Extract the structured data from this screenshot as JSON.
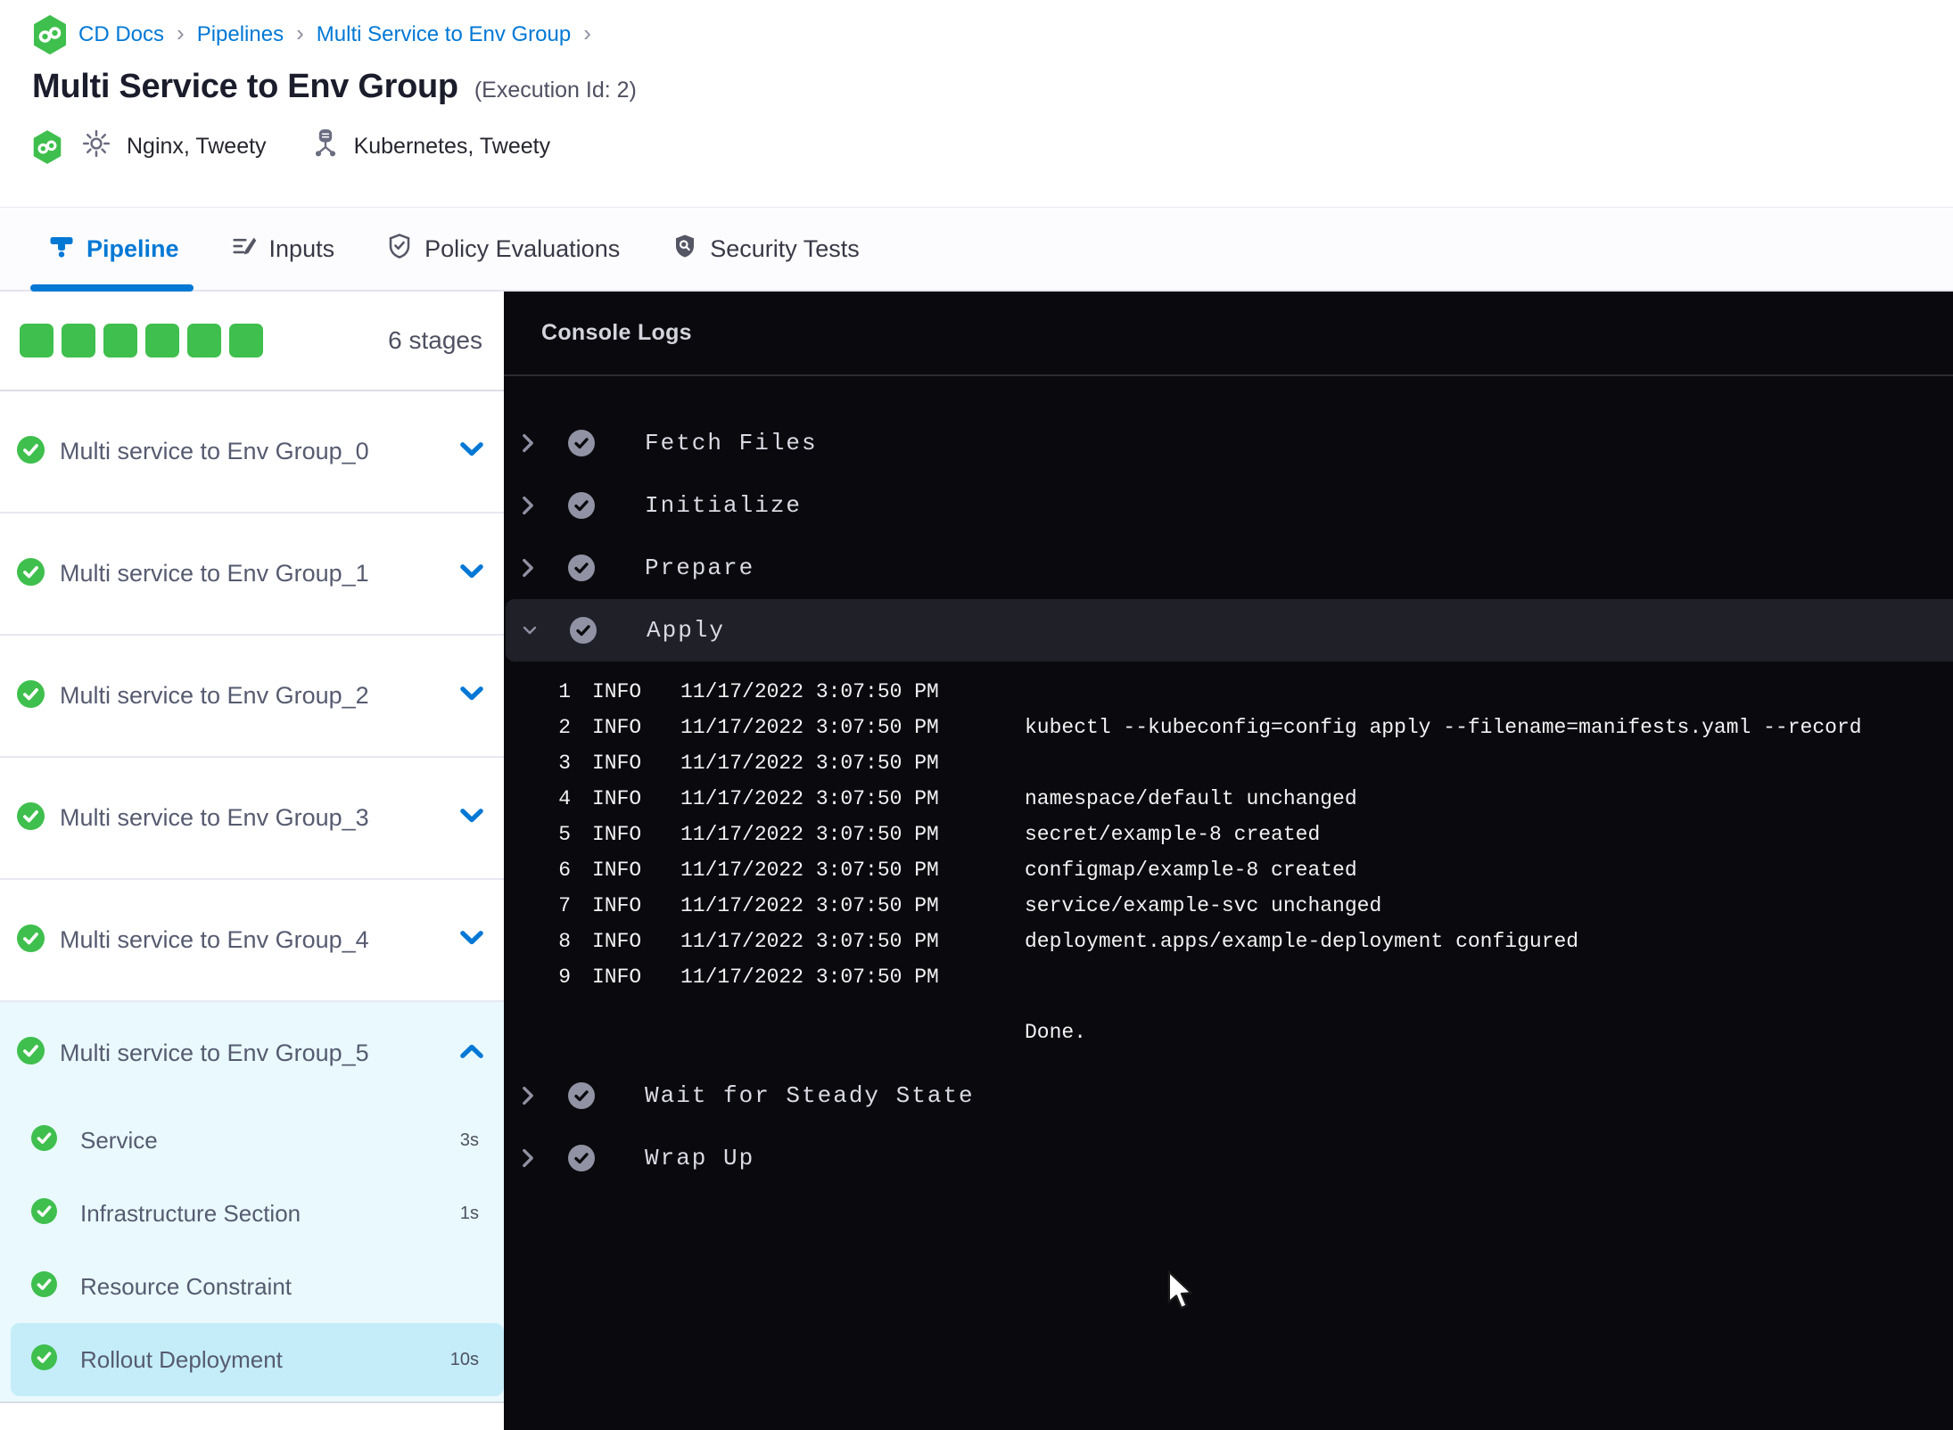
{
  "colors": {
    "accent_blue": "#0278d5",
    "success_green": "#3fbf4d",
    "console_background": "#0a0a0e",
    "selected_step_background": "#c4edf9",
    "expanded_stage_background": "#e9f9fd"
  },
  "breadcrumb": {
    "separator": "›",
    "items": [
      "CD Docs",
      "Pipelines",
      "Multi Service to Env Group"
    ]
  },
  "header": {
    "title": "Multi Service to Env Group",
    "execution_label": "(Execution Id: 2)",
    "services_label": "Nginx, Tweety",
    "environments_label": "Kubernetes, Tweety"
  },
  "tabs": [
    {
      "label": "Pipeline",
      "active": true
    },
    {
      "label": "Inputs",
      "active": false
    },
    {
      "label": "Policy Evaluations",
      "active": false
    },
    {
      "label": "Security Tests",
      "active": false
    }
  ],
  "sidebar": {
    "stage_count_label": "6 stages",
    "stages": [
      {
        "label": "Multi service to Env Group_0"
      },
      {
        "label": "Multi service to Env Group_1"
      },
      {
        "label": "Multi service to Env Group_2"
      },
      {
        "label": "Multi service to Env Group_3"
      },
      {
        "label": "Multi service to Env Group_4"
      }
    ],
    "expanded_stage": {
      "label": "Multi service to Env Group_5",
      "steps": [
        {
          "label": "Service",
          "duration": "3s"
        },
        {
          "label": "Infrastructure Section",
          "duration": "1s"
        },
        {
          "label": "Resource Constraint",
          "duration": ""
        },
        {
          "label": "Rollout Deployment",
          "duration": "10s"
        }
      ]
    }
  },
  "console": {
    "title": "Console Logs",
    "steps": [
      {
        "label": "Fetch Files"
      },
      {
        "label": "Initialize"
      },
      {
        "label": "Prepare"
      },
      {
        "label": "Apply"
      },
      {
        "label": "Wait for Steady State"
      },
      {
        "label": "Wrap Up"
      }
    ],
    "logs": [
      {
        "num": "1",
        "level": "INFO",
        "time": "11/17/2022 3:07:50 PM",
        "msg": ""
      },
      {
        "num": "2",
        "level": "INFO",
        "time": "11/17/2022 3:07:50 PM",
        "msg": "kubectl --kubeconfig=config apply --filename=manifests.yaml --record"
      },
      {
        "num": "3",
        "level": "INFO",
        "time": "11/17/2022 3:07:50 PM",
        "msg": ""
      },
      {
        "num": "4",
        "level": "INFO",
        "time": "11/17/2022 3:07:50 PM",
        "msg": "namespace/default unchanged"
      },
      {
        "num": "5",
        "level": "INFO",
        "time": "11/17/2022 3:07:50 PM",
        "msg": "secret/example-8 created"
      },
      {
        "num": "6",
        "level": "INFO",
        "time": "11/17/2022 3:07:50 PM",
        "msg": "configmap/example-8 created"
      },
      {
        "num": "7",
        "level": "INFO",
        "time": "11/17/2022 3:07:50 PM",
        "msg": "service/example-svc unchanged"
      },
      {
        "num": "8",
        "level": "INFO",
        "time": "11/17/2022 3:07:50 PM",
        "msg": "deployment.apps/example-deployment configured"
      },
      {
        "num": "9",
        "level": "INFO",
        "time": "11/17/2022 3:07:50 PM",
        "msg": ""
      }
    ],
    "done_label": "Done."
  }
}
